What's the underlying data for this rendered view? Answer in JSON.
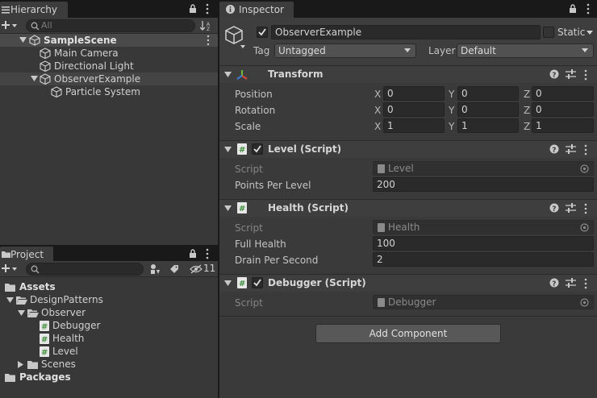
{
  "hierarchy": {
    "tab_label": "Hierarchy",
    "search_placeholder": "All",
    "scene": "SampleScene",
    "items": [
      "Main Camera",
      "Directional Light",
      "ObserverExample",
      "Particle System"
    ]
  },
  "project": {
    "tab_label": "Project",
    "hidden_count": "11",
    "tree": {
      "assets": "Assets",
      "design_patterns": "DesignPatterns",
      "observer": "Observer",
      "debugger": "Debugger",
      "health": "Health",
      "level": "Level",
      "scenes": "Scenes",
      "packages": "Packages"
    }
  },
  "inspector": {
    "tab_label": "Inspector",
    "object_name": "ObserverExample",
    "static_label": "Static",
    "tag_label": "Tag",
    "tag_value": "Untagged",
    "layer_label": "Layer",
    "layer_value": "Default",
    "transform": {
      "title": "Transform",
      "position_label": "Position",
      "rotation_label": "Rotation",
      "scale_label": "Scale",
      "x": "X",
      "y": "Y",
      "z": "Z",
      "position": [
        "0",
        "0",
        "0"
      ],
      "rotation": [
        "0",
        "0",
        "0"
      ],
      "scale": [
        "1",
        "1",
        "1"
      ]
    },
    "level_script": {
      "title": "Level (Script)",
      "script_label": "Script",
      "script_value": "Level",
      "field_label": "Points Per Level",
      "field_value": "200"
    },
    "health_script": {
      "title": "Health (Script)",
      "script_label": "Script",
      "script_value": "Health",
      "field1_label": "Full Health",
      "field1_value": "100",
      "field2_label": "Drain Per Second",
      "field2_value": "2"
    },
    "debugger_script": {
      "title": "Debugger (Script)",
      "script_label": "Script",
      "script_value": "Debugger"
    },
    "add_component": "Add Component"
  }
}
